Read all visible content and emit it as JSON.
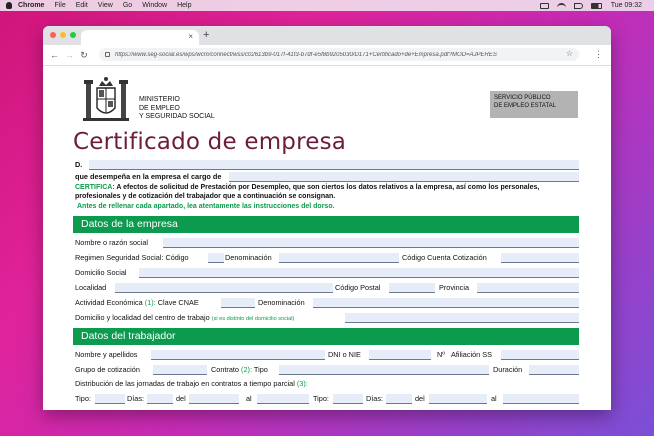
{
  "menubar": {
    "app": "Chrome",
    "items": [
      "File",
      "Edit",
      "View",
      "Go",
      "Window",
      "Help"
    ],
    "clock": "Tue 09:32"
  },
  "browser": {
    "tab_close": "×",
    "new_tab": "+",
    "url": "https://www.seg-social.es/wps/wcm/connect/wss/c02613b9-017f-41f3-b7df-e5f8b9205030/D171+Certificado+de+Empresa.pdf?MOD=AJPERES"
  },
  "header": {
    "ministry_lines": [
      "MINISTERIO",
      "DE EMPLEO",
      "Y SEGURIDAD SOCIAL"
    ],
    "sepe_lines": [
      "SERVICIO PÚBLICO",
      "DE EMPLEO ESTATAL"
    ]
  },
  "form": {
    "title": "Certificado de empresa",
    "d_label": "D.",
    "cargo_label": "que desempeña en la empresa el cargo de",
    "certifica_label": "CERTIFICA:",
    "certifica_text_1": " A efectos de solicitud de Prestación por Desempleo, que son ciertos los datos relativos a la empresa, así como los personales,",
    "certifica_text_2": "profesionales y de cotización del trabajador que a continuación se consignan.",
    "antes_text": "Antes de rellenar cada apartado, lea   atentamente las instrucciones del dorso.",
    "empresa_section": {
      "title": "Datos de la empresa",
      "nombre": "Nombre o razón social",
      "regimen": "Regimen Seguridad Social: Código",
      "denominacion": "Denominación",
      "codigo_cc": "Código Cuenta Cotización",
      "domicilio": "Domicilio Social",
      "localidad": "Localidad",
      "codigo_postal": "Código Postal",
      "provincia": "Provincia",
      "actividad": "Actividad Económica",
      "actividad_note": "(1):",
      "clave_cnae": "Clave CNAE",
      "denominacion2": "Denominación",
      "domicilio_centro": "Domicilio y localidad del centro de trabajo",
      "domicilio_centro_note": "(si es distinto del domicilio social)"
    },
    "trabajador_section": {
      "title": "Datos del trabajador",
      "nombre": "Nombre y apellidos",
      "dni": "DNI o NIE",
      "num": "Nº",
      "afiliacion": "Afiliación SS",
      "grupo": "Grupo de cotización",
      "contrato": "Contrato",
      "contrato_note": "(2):",
      "tipo": "Tipo",
      "duracion": "Duración",
      "distribucion": "Distribución de las jornadas de trabajo en contratos a tiempo parcial",
      "distribucion_note": "(3):",
      "tipo_label": "Tipo:",
      "dias_label": "Días:",
      "del_label": "del",
      "al_label": "al"
    }
  }
}
